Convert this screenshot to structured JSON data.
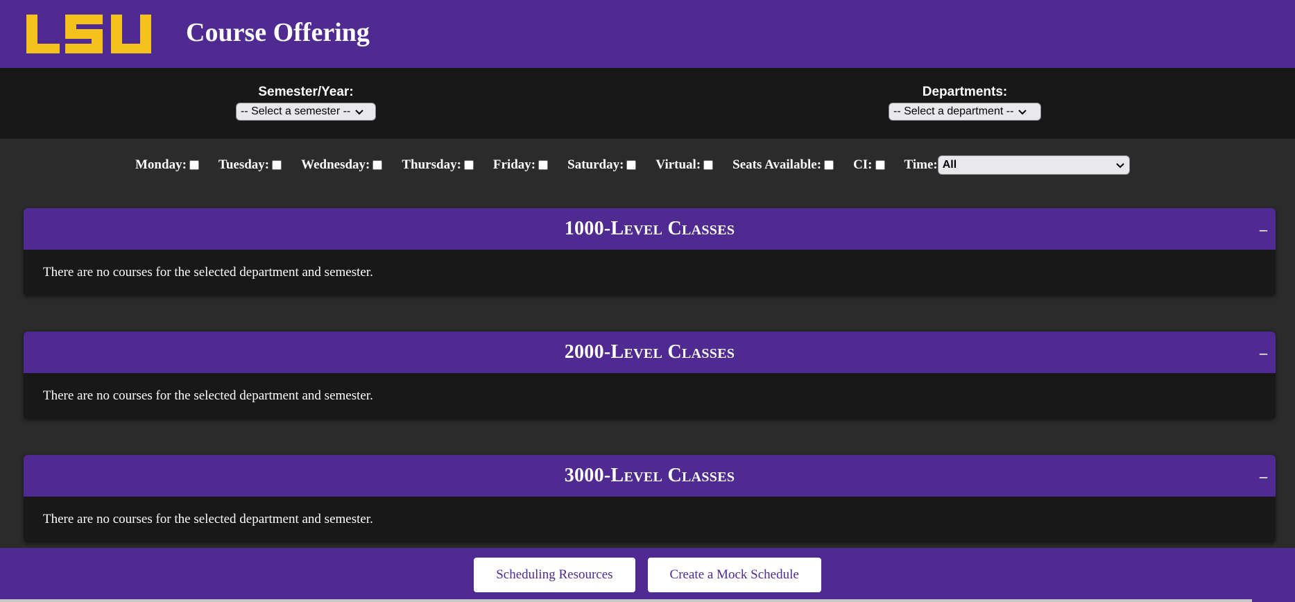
{
  "header": {
    "logo_text": "LSU",
    "title": "Course Offering"
  },
  "selectors": {
    "semester": {
      "label": "Semester/Year:",
      "value": "-- Select a semester --"
    },
    "department": {
      "label": "Departments:",
      "value": "-- Select a department --"
    }
  },
  "filters": {
    "monday": "Monday:",
    "tuesday": "Tuesday:",
    "wednesday": "Wednesday:",
    "thursday": "Thursday:",
    "friday": "Friday:",
    "saturday": "Saturday:",
    "virtual": "Virtual:",
    "seats": "Seats Available:",
    "ci": "CI:",
    "time_label": "Time:",
    "time_value": "All"
  },
  "sections": [
    {
      "title": "1000-Level Classes",
      "toggle": "–",
      "message": "There are no courses for the selected department and semester."
    },
    {
      "title": "2000-Level Classes",
      "toggle": "–",
      "message": "There are no courses for the selected department and semester."
    },
    {
      "title": "3000-Level Classes",
      "toggle": "–",
      "message": "There are no courses for the selected department and semester."
    }
  ],
  "footer": {
    "resources": "Scheduling Resources",
    "mock": "Create a Mock Schedule"
  },
  "colors": {
    "primary": "#4e2a91",
    "logo": "#f4c21f"
  }
}
